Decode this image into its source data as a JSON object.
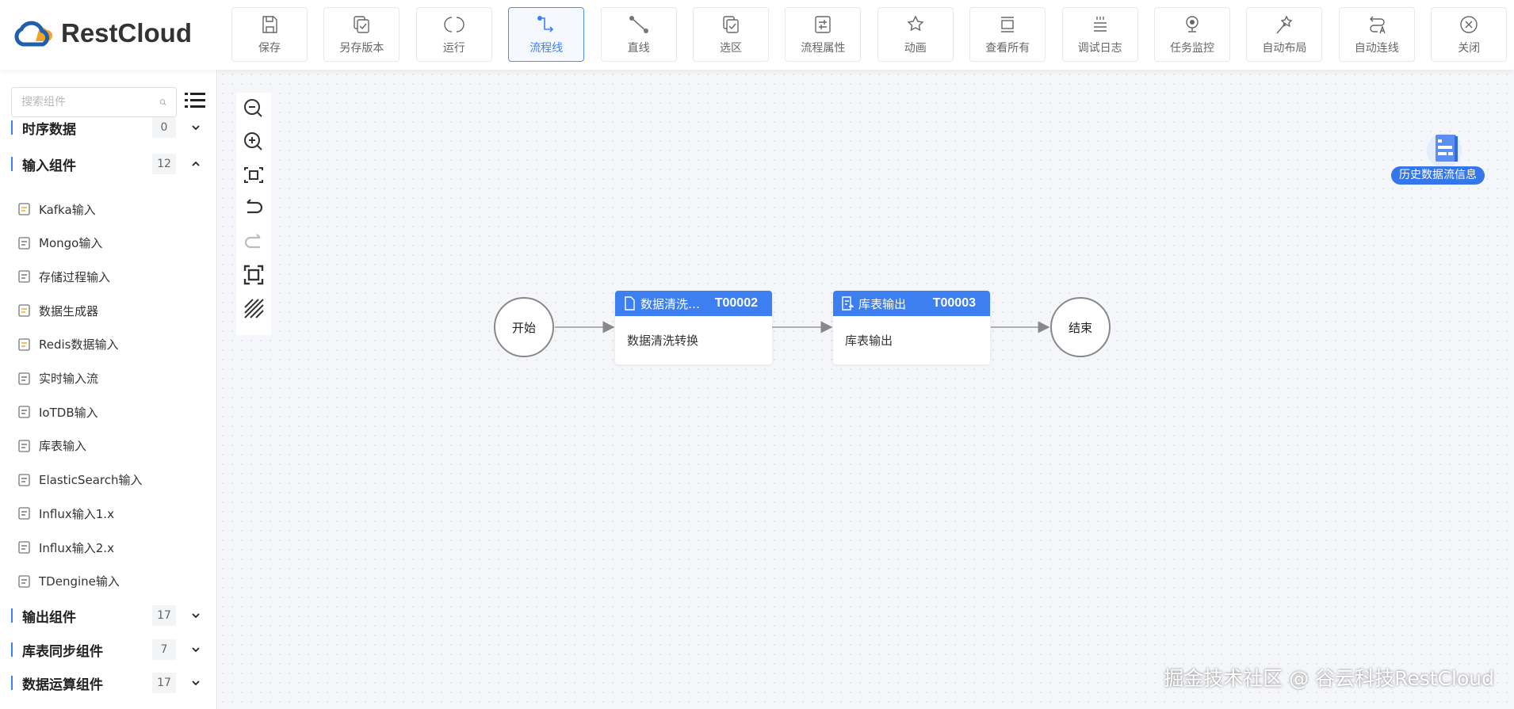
{
  "app": {
    "logo_text": "RestCloud"
  },
  "toolbar": [
    {
      "label": "保存",
      "icon": "save-icon"
    },
    {
      "label": "另存版本",
      "icon": "save-version-icon"
    },
    {
      "label": "运行",
      "icon": "run-icon"
    },
    {
      "label": "流程线",
      "icon": "flow-line-icon",
      "active": true
    },
    {
      "label": "直线",
      "icon": "straight-line-icon"
    },
    {
      "label": "选区",
      "icon": "selection-icon"
    },
    {
      "label": "流程属性",
      "icon": "properties-icon"
    },
    {
      "label": "动画",
      "icon": "animation-icon"
    },
    {
      "label": "查看所有",
      "icon": "view-all-icon"
    },
    {
      "label": "调试日志",
      "icon": "debug-log-icon"
    },
    {
      "label": "任务监控",
      "icon": "monitor-icon"
    },
    {
      "label": "自动布局",
      "icon": "auto-layout-icon"
    },
    {
      "label": "自动连线",
      "icon": "auto-connect-icon"
    },
    {
      "label": "关闭",
      "icon": "close-icon"
    }
  ],
  "sidebar": {
    "search_placeholder": "搜索组件",
    "categories": [
      {
        "name": "时序数据",
        "count": "0",
        "expanded": false
      },
      {
        "name": "输入组件",
        "count": "12",
        "expanded": true
      },
      {
        "name": "输出组件",
        "count": "17",
        "expanded": false
      },
      {
        "name": "库表同步组件",
        "count": "7",
        "expanded": false
      },
      {
        "name": "数据运算组件",
        "count": "17",
        "expanded": false
      }
    ],
    "input_items": [
      "Kafka输入",
      "Mongo输入",
      "存储过程输入",
      "数据生成器",
      "Redis数据输入",
      "实时输入流",
      "IoTDB输入",
      "库表输入",
      "ElasticSearch输入",
      "Influx输入1.x",
      "Influx输入2.x",
      "TDengine输入"
    ]
  },
  "flow": {
    "start": "开始",
    "end": "结束",
    "nodes": [
      {
        "title": "数据清洗…",
        "id": "T00002",
        "body": "数据清洗转换"
      },
      {
        "title": "库表输出",
        "id": "T00003",
        "body": "库表输出"
      }
    ]
  },
  "history_label": "历史数据流信息",
  "watermark": "掘金技术社区 @ 谷云科技RestCloud",
  "colors": {
    "accent": "#3d7ff0",
    "orange": "#f0a52a"
  }
}
